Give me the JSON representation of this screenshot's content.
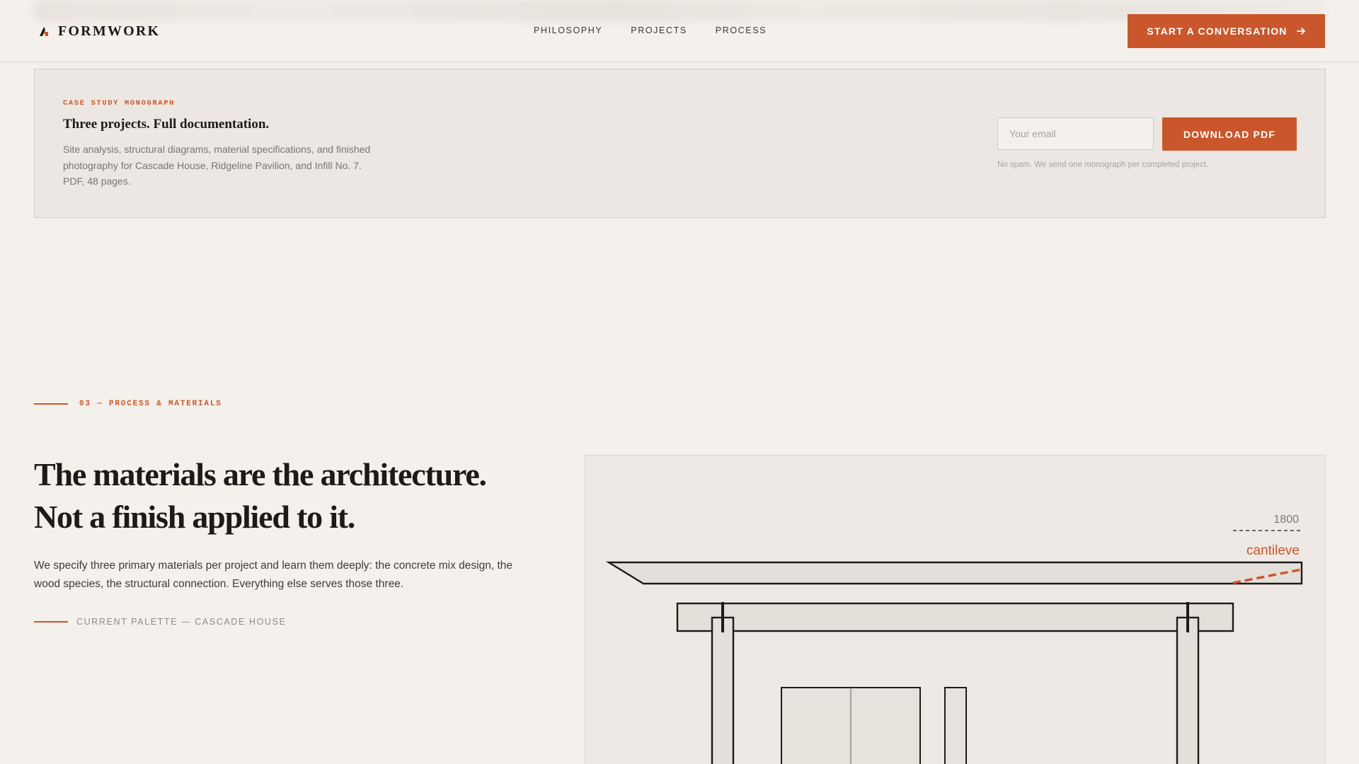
{
  "header": {
    "logo_text": "FORMWORK",
    "logo_icon": "formwork-mark-icon",
    "nav": [
      {
        "label": "PHILOSOPHY"
      },
      {
        "label": "PROJECTS"
      },
      {
        "label": "PROCESS"
      }
    ],
    "cta_label": "START A CONVERSATION",
    "cta_icon": "arrow-right-icon"
  },
  "monograph": {
    "eyebrow": "CASE STUDY MONOGRAPH",
    "title": "Three projects. Full documentation.",
    "description": "Site analysis, structural diagrams, material specifications, and finished photography for Cascade House, Ridgeline Pavilion, and Infill No. 7. PDF, 48 pages.",
    "email_placeholder": "Your email",
    "download_label": "DOWNLOAD PDF",
    "note": "No spam. We send one monograph per completed project."
  },
  "process": {
    "section_label": "03 — PROCESS & MATERIALS",
    "headline_line1": "The materials are the architecture.",
    "headline_line2": "Not a finish applied to it.",
    "body": "We specify three primary materials per project and learn them deeply: the concrete mix design, the wood species, the structural connection. Everything else serves those three.",
    "palette_label": "CURRENT PALETTE — CASCADE HOUSE"
  },
  "drawing": {
    "dimension_value": "1800",
    "annotation": "cantileve"
  },
  "colors": {
    "accent": "#c9572b",
    "background": "#f4f0eb",
    "card_background": "#ece7e2",
    "ink": "#1c1b19"
  }
}
